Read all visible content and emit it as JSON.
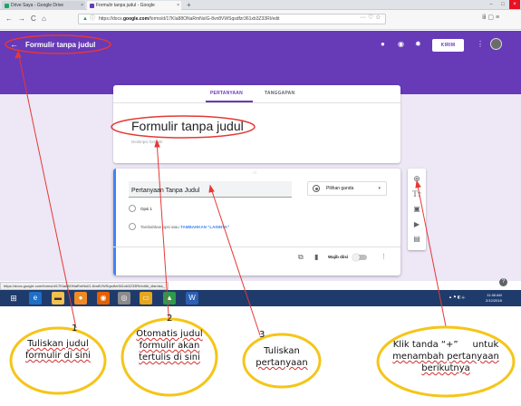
{
  "browser": {
    "tabs": [
      {
        "label": "Drive Saya - Google Drive",
        "close": "×",
        "color": "#1fa463"
      },
      {
        "label": "Formulir tanpa judul - Google",
        "close": "×",
        "color": "#673ab7"
      }
    ],
    "new_tab": "+",
    "window_controls": {
      "minimize": "–",
      "maximize": "□",
      "close": "×"
    },
    "nav": {
      "back": "←",
      "forward": "→",
      "reload": "C",
      "home": "⌂"
    },
    "url_prefix": "https://docs.",
    "url_domain": "google.com",
    "url_path": "/forms/d/17KIa88ONaRmNsIG-8vn8VWSqsdfzr361xb3Z33RI/edit",
    "url_right_icons": "··· ♡ ☆",
    "toolbar_right_icons": "ⅲ ▢ ≡"
  },
  "forms_header": {
    "back": "←",
    "title": "Formulir tanpa judul",
    "send_label": "KIRIM",
    "icons": [
      "palette-icon",
      "preview-icon",
      "settings-icon",
      "more-icon"
    ]
  },
  "form_tabs": {
    "questions": "PERTANYAAN",
    "responses": "TANGGAPAN"
  },
  "form": {
    "title": "Formulir tanpa judul",
    "description_placeholder": "Deskripsi formulir"
  },
  "question": {
    "drag": "⁝⁝⁝",
    "title": "Pertanyaan Tanpa Judul",
    "type": "Pilihan ganda",
    "option1": "Opsi 1",
    "add_option_prefix": "Tambahkan opsi",
    "add_option_mid": " atau ",
    "add_other": "TAMBAHKAN \"LAINNYA\"",
    "required_label": "Wajib diisi"
  },
  "side_toolbar": [
    "add-question-icon",
    "title-text-icon",
    "image-icon",
    "video-icon",
    "section-icon"
  ],
  "status_url": "https://docs.google.com/forms/d/17KIa88ONaRmNsIG-8vn8VWSqsdfzr361xb3Z33RI/edit#_dismiss_",
  "taskbar": {
    "clock_time": "11:48 AM",
    "clock_date": "2/12/2018",
    "tray": "▲ ⚑ ◧ 🔈"
  },
  "annotations": [
    {
      "number": "1",
      "text": [
        "Tuliskan judul",
        "formulir di sini"
      ]
    },
    {
      "number": "2",
      "text": [
        "Otomatis judul",
        "formulir akan",
        "tertulis di sini"
      ]
    },
    {
      "number": "3",
      "text": [
        "Tuliskan",
        "pertanyaan"
      ]
    },
    {
      "number": "",
      "text": [
        "Klik tanda “+”     untuk",
        "menambah pertanyaan",
        "berikutnya"
      ]
    }
  ],
  "colors": {
    "forms_purple": "#673ab7",
    "page_bg": "#ede7f6",
    "question_accent": "#4285f4",
    "annotation_red": "#e53935",
    "annotation_yellow": "#f5c518"
  }
}
